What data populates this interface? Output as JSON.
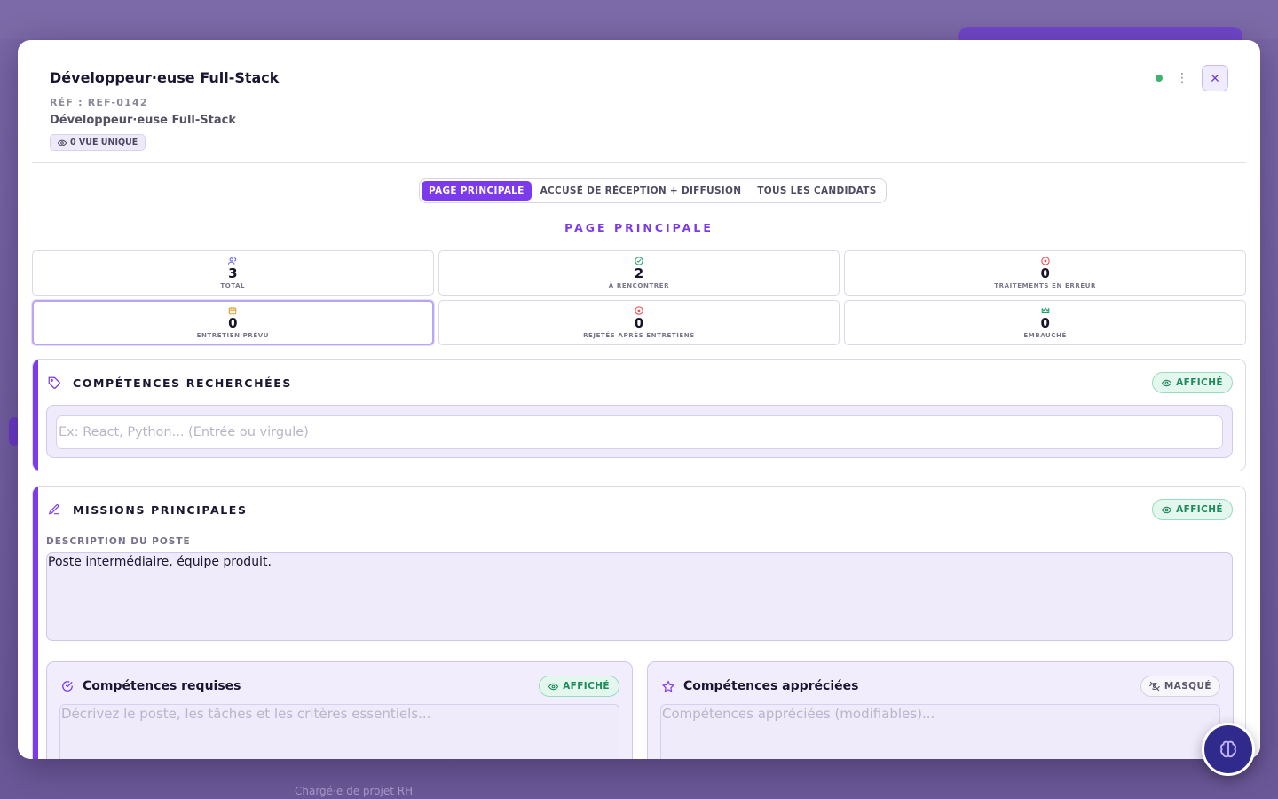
{
  "background": {
    "behind_text": "Chargé·e de projet RH"
  },
  "header": {
    "title": "Développeur·euse Full-Stack",
    "ref": "RÉF : REF-0142",
    "subtitle": "Développeur·euse Full-Stack",
    "views_badge": "0 VUE UNIQUE",
    "status_color": "#3cb46e",
    "kebab_glyph": "⋮",
    "close_glyph": "✕"
  },
  "tabs": [
    {
      "label": "PAGE PRINCIPALE",
      "active": true
    },
    {
      "label": "ACCUSÉ DE RÉCEPTION + DIFFUSION",
      "active": false
    },
    {
      "label": "TOUS LES CANDIDATS",
      "active": false
    }
  ],
  "section_title": "PAGE PRINCIPALE",
  "stats": [
    {
      "value": "3",
      "label": "TOTAL",
      "icon": "users-icon",
      "color": "#6366f1"
    },
    {
      "value": "2",
      "label": "À RENCONTRER",
      "icon": "check-circle-icon",
      "color": "#22a06b"
    },
    {
      "value": "0",
      "label": "TRAITEMENTS EN ERREUR",
      "icon": "x-circle-icon",
      "color": "#e5484d"
    },
    {
      "value": "0",
      "label": "ENTRETIEN PRÉVU",
      "icon": "calendar-icon",
      "color": "#e09b2d"
    },
    {
      "value": "0",
      "label": "REJETÉS APRÈS ENTRETIENS",
      "icon": "x-circle-icon",
      "color": "#e5484d"
    },
    {
      "value": "0",
      "label": "EMBAUCHÉ",
      "icon": "crown-icon",
      "color": "#22a06b"
    }
  ],
  "skills_card": {
    "title": "COMPÉTENCES RECHERCHÉES",
    "visibility": "AFFICHÉ",
    "placeholder": "Ex: React, Python... (Entrée ou virgule)"
  },
  "missions_card": {
    "title": "MISSIONS PRINCIPALES",
    "visibility": "AFFICHÉ",
    "desc_label": "DESCRIPTION DU POSTE",
    "desc_value": "Poste intermédiaire, équipe produit.",
    "required": {
      "title": "Compétences requises",
      "visibility": "AFFICHÉ",
      "placeholder": "Décrivez le poste, les tâches et les critères essentiels..."
    },
    "preferred": {
      "title": "Compétences appréciées",
      "visibility": "MASQUÉ",
      "placeholder": "Compétences appréciées (modifiables)..."
    }
  },
  "accent_color": "#7c3aed"
}
